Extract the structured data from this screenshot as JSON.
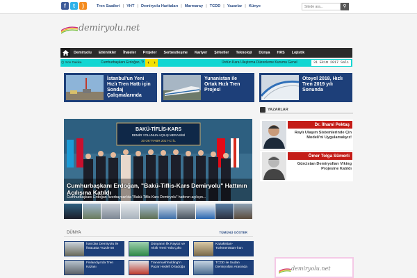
{
  "topbar": {
    "social": [
      {
        "icon": "facebook-icon",
        "glyph": "f",
        "color": "#3b5998"
      },
      {
        "icon": "twitter-icon",
        "glyph": "t",
        "color": "#2fb2e9"
      },
      {
        "icon": "rss-icon",
        "glyph": "r",
        "color": "#f48b1e"
      }
    ],
    "nav": [
      "Tren Saatleri",
      "YHT",
      "Demiryolu Haritaları",
      "Marmaray",
      "TCDD",
      "Yazarlar",
      "Künye"
    ],
    "search_placeholder": "Sitede ara..."
  },
  "logo": {
    "text": "demiryolu.net"
  },
  "mainnav": [
    "Demiryolu",
    "Etkinlikler",
    "İhaleler",
    "Projeler",
    "Serbestleşme",
    "Kariyer",
    "Şirketler",
    "Teknoloji",
    "Dünya",
    "HRS",
    "Lojistik"
  ],
  "ticker": {
    "label": "Son Dakika",
    "headline1": "Cumhurbaşkanı Erdoğan, \"Bakü-Tiflis-Kars",
    "headline2": "Ürdün Kara Ulaştırma Düzenleme Kurumu Genel",
    "date": "31 Ekim 2017 Salı"
  },
  "featured": [
    {
      "title": "İstanbul'un Yeni Hızlı Tren Hattı için Sondaj Çalışmalarında"
    },
    {
      "title": "Yunanistan ile Ortak Hızlı Tren Projesi"
    },
    {
      "title": "Otoyol 2018, Hızlı Tren 2019 yılı Sonunda"
    }
  ],
  "slider": {
    "banner_line1": "BAKÜ-TİFLİS-KARS",
    "banner_line2": "DEMİR YOLUNUN AÇILIŞ MERASİMİ",
    "banner_line3": "30 OKTYABR 2017-Cİ İL",
    "caption": "Cumhurbaşkanı Erdoğan, \"Bakü-Tiflis-Kars Demiryolu\" Hattının Açılışına Katıldı",
    "subcaption": "Cumhurbaşkanı Erdoğan Azerbaycan'da \"Bakü-Tiflis-Kars Demiryolu\" hattının açılışın..."
  },
  "section": {
    "title": "DÜNYA",
    "all_label": "TÜMÜNÜ GÖSTER"
  },
  "world_news": [
    {
      "title": "İran'dan Demiryolu ile İhracatta Yüzde 50"
    },
    {
      "title": "Dünyanın İlk Raysız ve Akıllı Treni Yola Çıktı"
    },
    {
      "title": "Kazakistan-Türkmenistan-İran"
    },
    {
      "title": "Finlandiya'da Tren Kazası"
    },
    {
      "title": "Transmashholding'in Pazar Hedefi Ortadoğu"
    },
    {
      "title": "TCDD ile Sudan Demiryolları Arasında"
    }
  ],
  "sidebar": {
    "heading": "YAZARLAR",
    "authors": [
      {
        "name": "Dr. İlhami Pektaş",
        "title": "Raylı Ulaşım Sistemlerinde Çin Modeli'ni Uygulamalıyız!"
      },
      {
        "name": "Ömer Tolga Sümerli",
        "title": "Gürcistan Demiryolları Viking Projesine Katıldı"
      }
    ]
  },
  "banner": {
    "text": "demiryolu.net"
  },
  "colors": {
    "accent": "#1d3f79",
    "ticker": "#12d6d2",
    "arrow": "#f3e100",
    "author_bar": "#c41c17"
  }
}
